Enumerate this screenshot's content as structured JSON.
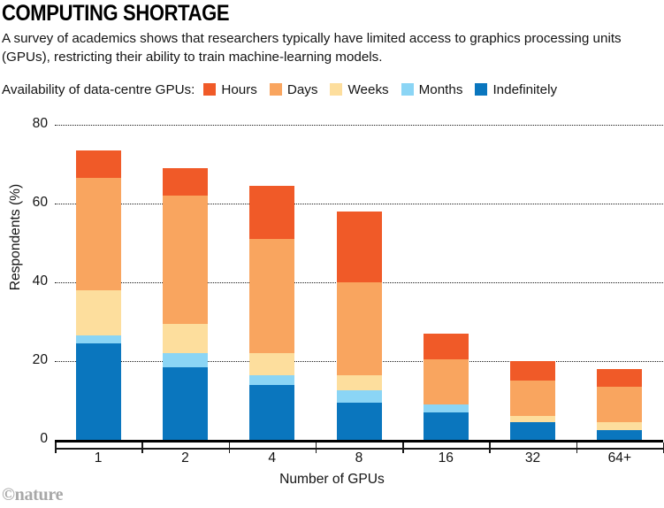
{
  "header": {
    "title": "COMPUTING SHORTAGE",
    "subtitle": "A survey of academics shows that researchers typically have limited access to graphics processing units (GPUs), restricting their ability to train machine-learning models."
  },
  "legend": {
    "title": "Availability of data-centre GPUs:",
    "position": "top",
    "items": [
      {
        "label": "Hours",
        "color": "#F05A28"
      },
      {
        "label": "Days",
        "color": "#F9A55F"
      },
      {
        "label": "Weeks",
        "color": "#FDDE9D"
      },
      {
        "label": "Months",
        "color": "#8BD5F5"
      },
      {
        "label": "Indefinitely",
        "color": "#0A76BE"
      }
    ]
  },
  "footer": {
    "logo": "©nature"
  },
  "chart_data": {
    "type": "bar",
    "subtype": "stacked-bar",
    "title": "COMPUTING SHORTAGE",
    "subtitle": "A survey of academics shows that researchers typically have limited access to graphics processing units (GPUs), restricting their ability to train machine-learning models.",
    "xlabel": "Number of GPUs",
    "ylabel": "Respondents (%)",
    "categories": [
      "1",
      "2",
      "4",
      "8",
      "16",
      "32",
      "64+"
    ],
    "ylim": [
      0,
      80
    ],
    "yticks": [
      0,
      20,
      40,
      60,
      80
    ],
    "ytick_labels": [
      "0",
      "20",
      "40",
      "60",
      "80"
    ],
    "grid": "horizontal-dotted",
    "stack_order_bottom_to_top": [
      "Indefinitely",
      "Months",
      "Weeks",
      "Days",
      "Hours"
    ],
    "series": [
      {
        "name": "Indefinitely",
        "color": "#0A76BE",
        "values": [
          24.5,
          18.5,
          14,
          9.5,
          7,
          4.5,
          2.5
        ]
      },
      {
        "name": "Months",
        "color": "#8BD5F5",
        "values": [
          2,
          3.5,
          2.5,
          3,
          2,
          0,
          0
        ]
      },
      {
        "name": "Weeks",
        "color": "#FDDE9D",
        "values": [
          11.5,
          7.5,
          5.5,
          4,
          0,
          1.5,
          2
        ]
      },
      {
        "name": "Days",
        "color": "#F9A55F",
        "values": [
          28.5,
          32.5,
          29,
          23.5,
          11.5,
          9,
          9
        ]
      },
      {
        "name": "Hours",
        "color": "#F05A28",
        "values": [
          7,
          7,
          13.5,
          18,
          6.5,
          5,
          4.5
        ]
      }
    ],
    "totals": [
      73.5,
      69,
      64.5,
      58,
      27,
      20,
      18
    ]
  }
}
